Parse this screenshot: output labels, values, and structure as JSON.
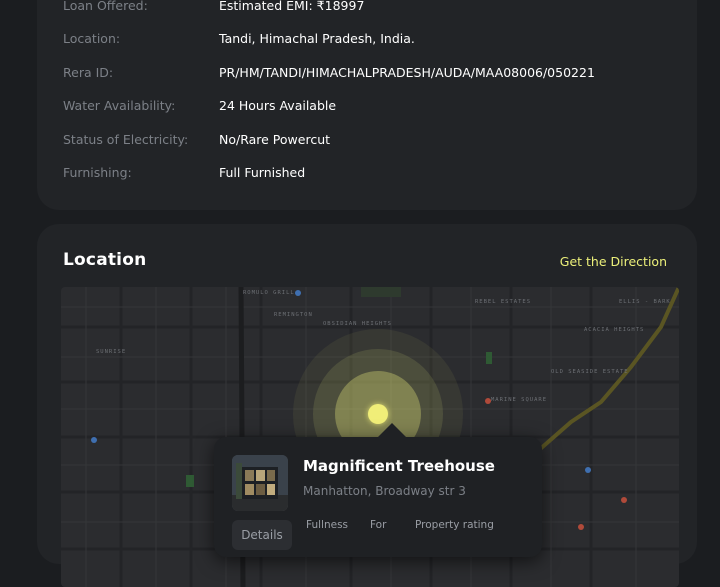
{
  "details": {
    "rows": [
      {
        "key": "Loan Offered:",
        "value": "Estimated EMI: ₹18997"
      },
      {
        "key": "Location:",
        "value": "Tandi, Himachal Pradesh, India."
      },
      {
        "key": "Rera ID:",
        "value": "PR/HM/TANDI/HIMACHALPRADESH/AUDA/MAA08006/050221"
      },
      {
        "key": "Water Availability:",
        "value": "24 Hours Available"
      },
      {
        "key": "Status of Electricity:",
        "value": "No/Rare Powercut"
      },
      {
        "key": "Furnishing:",
        "value": "Full Furnished"
      }
    ]
  },
  "location": {
    "title": "Location",
    "direction_link": "Get the Direction",
    "map_labels": [
      "Romulo Grill",
      "Remington",
      "Obsidian Heights",
      "Rebel Estates",
      "Ellis - Bark",
      "Sunrise",
      "Acacia Heights",
      "Old Seaside Estate",
      "Marine Square"
    ],
    "pin_color": "#f0ee78"
  },
  "popup": {
    "title": "Magnificent Treehouse",
    "address": "Manhatton, Broadway str 3",
    "details_label": "Details",
    "stat_labels": [
      "Fullness",
      "For",
      "Property rating"
    ]
  },
  "colors": {
    "background": "#1b1d20",
    "card": "#222427",
    "accent": "#ecf07a",
    "muted_text": "#7c8087"
  }
}
